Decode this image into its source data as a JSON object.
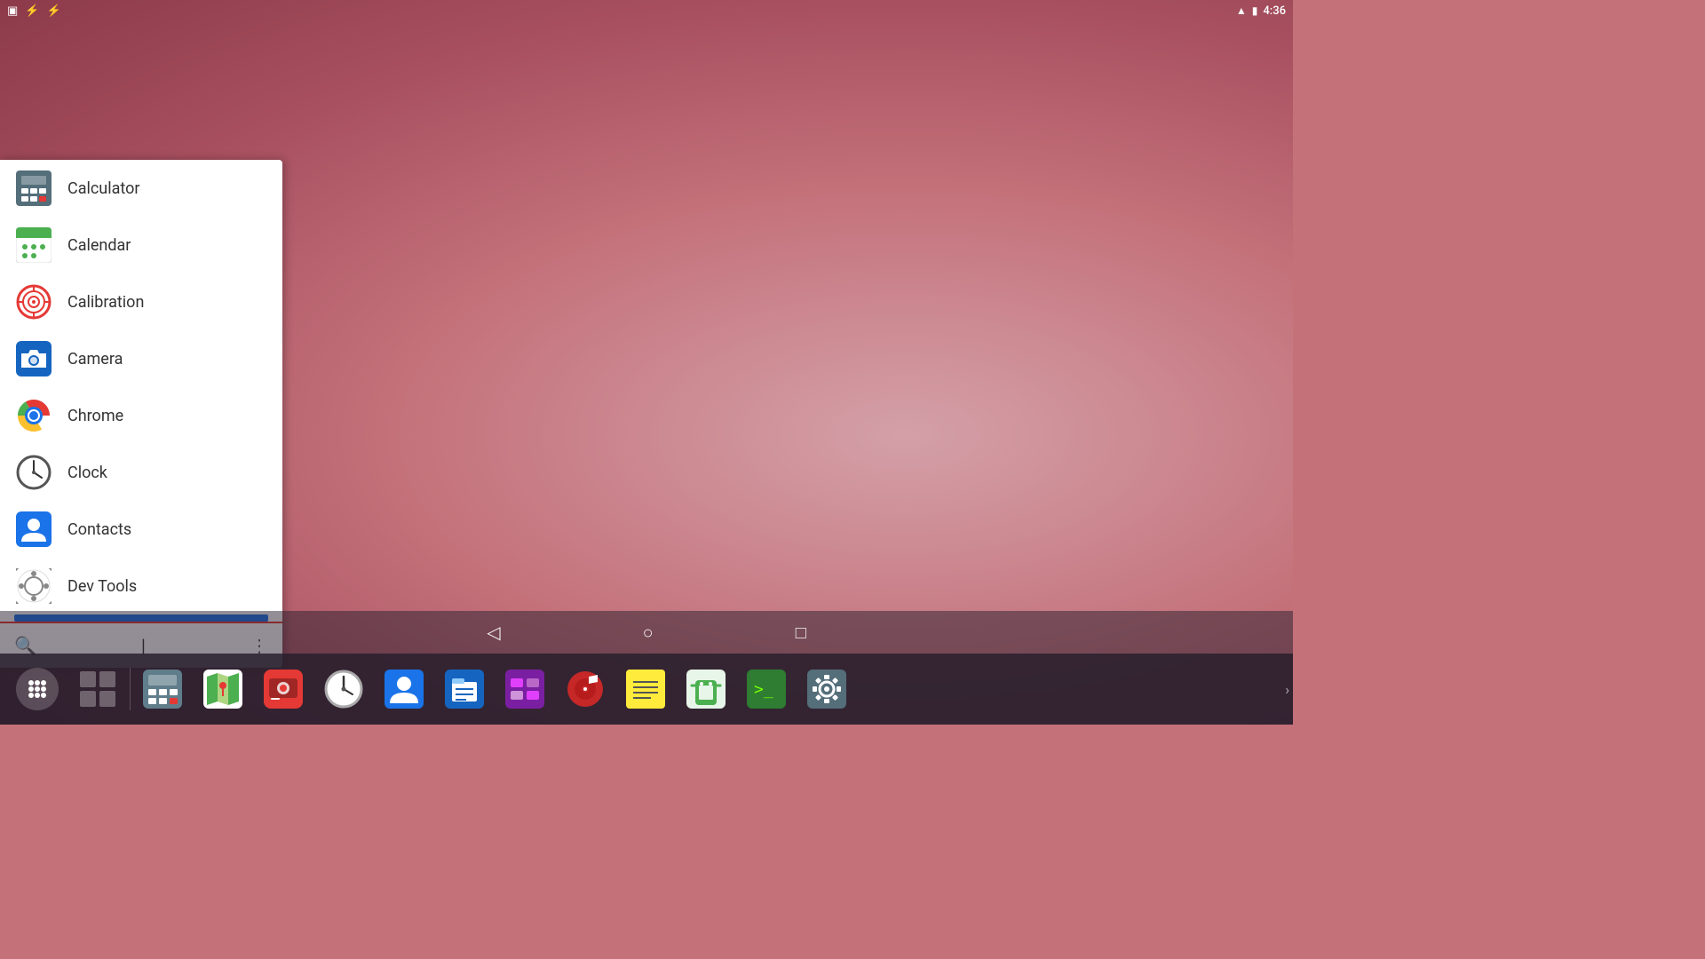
{
  "statusBar": {
    "leftIcons": [
      "screen-icon",
      "usb-icon",
      "usb2-icon"
    ],
    "rightIcons": [
      "wifi-icon",
      "battery-icon"
    ],
    "time": "4:36"
  },
  "appDrawer": {
    "apps": [
      {
        "id": "calculator",
        "label": "Calculator"
      },
      {
        "id": "calendar",
        "label": "Calendar"
      },
      {
        "id": "calibration",
        "label": "Calibration"
      },
      {
        "id": "camera",
        "label": "Camera"
      },
      {
        "id": "chrome",
        "label": "Chrome"
      },
      {
        "id": "clock",
        "label": "Clock"
      },
      {
        "id": "contacts",
        "label": "Contacts"
      },
      {
        "id": "devtools",
        "label": "Dev Tools"
      }
    ],
    "searchPlaceholder": "",
    "cursor": "|"
  },
  "taskbar": {
    "apps": [
      {
        "id": "app-drawer-btn",
        "label": "App Drawer"
      },
      {
        "id": "grid-btn",
        "label": "Grid"
      },
      {
        "id": "calc-btn",
        "label": "Calculator"
      },
      {
        "id": "map-btn",
        "label": "Maps"
      },
      {
        "id": "cam-btn",
        "label": "Camera"
      },
      {
        "id": "clock-btn",
        "label": "Clock"
      },
      {
        "id": "contacts-btn",
        "label": "Contacts"
      },
      {
        "id": "files-btn",
        "label": "Files"
      },
      {
        "id": "gallery-btn",
        "label": "Gallery"
      },
      {
        "id": "music-btn",
        "label": "Music"
      },
      {
        "id": "notes-btn",
        "label": "Notes"
      },
      {
        "id": "android-btn",
        "label": "Android"
      },
      {
        "id": "terminal-btn",
        "label": "Terminal"
      },
      {
        "id": "settings-btn",
        "label": "Settings"
      }
    ]
  },
  "navBar": {
    "back": "◁",
    "home": "○",
    "recents": "□"
  }
}
